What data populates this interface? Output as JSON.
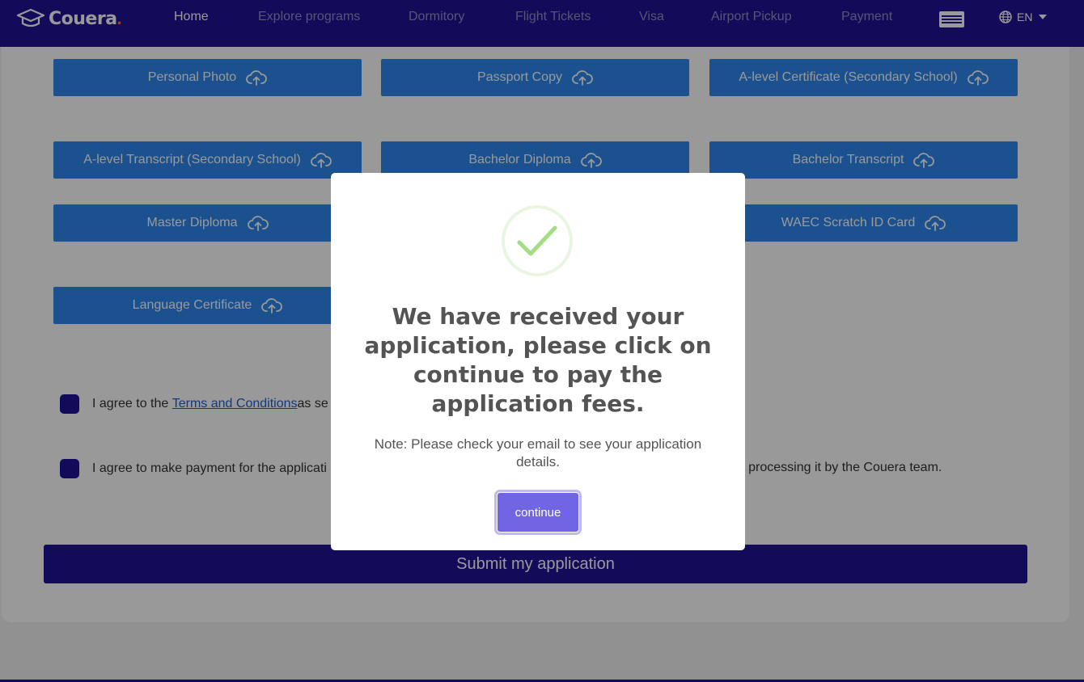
{
  "brand": {
    "name": "Couera",
    "dot": "."
  },
  "nav": {
    "items": [
      {
        "label": "Home",
        "active": true
      },
      {
        "label": "Explore programs",
        "active": false
      },
      {
        "label": "Dormitory",
        "active": false
      },
      {
        "label": "Flight Tickets",
        "active": false
      },
      {
        "label": "Visa",
        "active": false
      },
      {
        "label": "Airport Pickup",
        "active": false
      },
      {
        "label": "Payment",
        "active": false
      }
    ],
    "menu_icon": "hamburger-icon",
    "language": "EN"
  },
  "uploads": [
    {
      "label": "Personal Photo"
    },
    {
      "label": "Passport Copy"
    },
    {
      "label": "A-level Certificate (Secondary School)"
    },
    {
      "label": "A-level Transcript (Secondary School)"
    },
    {
      "label": "Bachelor Diploma"
    },
    {
      "label": "Bachelor Transcript"
    },
    {
      "label": "Master Diploma"
    },
    {
      "label": "WAEC Scratch ID Card"
    },
    {
      "label": "Language Certificate"
    }
  ],
  "agreements": {
    "terms": {
      "prefix": "I agree to the ",
      "link": "Terms and Conditions ",
      "suffix": "as se"
    },
    "payment": {
      "prefix": "I agree to make payment for the applicati",
      "suffix": "art processing it by the Couera team."
    }
  },
  "submit_label": "Submit my application",
  "modal": {
    "title": "We have received your application, please click on continue to pay the application fees.",
    "note": "Note: Please check your email to see your application details.",
    "continue_label": "continue",
    "icon": "success-check-icon"
  },
  "colors": {
    "primary": "#201397",
    "upload_button": "#2f88f1",
    "confirm_button": "#7065e3",
    "success": "#a5dc86"
  }
}
